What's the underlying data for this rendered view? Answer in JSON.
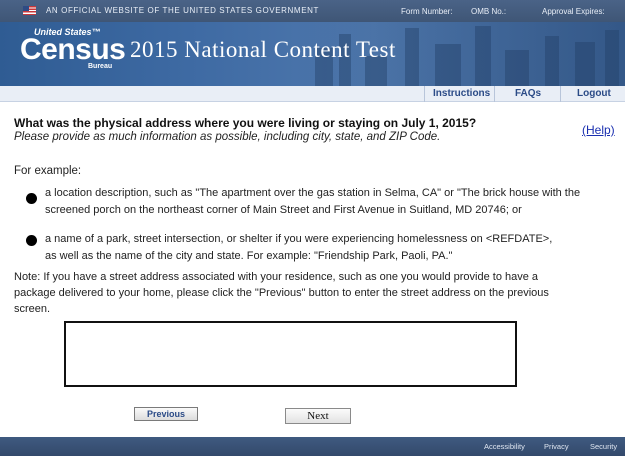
{
  "gov_strip": {
    "text": "AN OFFICIAL WEBSITE OF THE UNITED STATES GOVERNMENT",
    "form_number": "Form Number:",
    "omb_no": "OMB No.:",
    "approval_expires": "Approval Expires:"
  },
  "header": {
    "logo_united_states": "United States™",
    "logo_census": "Census",
    "logo_bureau": "Bureau",
    "title": "2015 National Content Test"
  },
  "nav": {
    "instructions": "Instructions",
    "faqs": "FAQs",
    "logout": "Logout"
  },
  "question": {
    "text": "What was the physical address where you were living or staying on July 1, 2015?",
    "subtitle": "Please provide as much information as possible, including city, state, and ZIP Code.",
    "help": "(Help)"
  },
  "examples": {
    "heading": "For example:",
    "items": [
      {
        "line1": "a location description, such as \"The apartment over the gas station in Selma, CA\" or \"The brick house with the",
        "line2": "screened porch on the northeast corner of Main Street and First Avenue in Suitland, MD 20746; or"
      },
      {
        "line1": "a name of a park, street intersection, or shelter if you were experiencing homelessness on <REFDATE>,",
        "line2": "as well as the name of the city and state.  For example: \"Friendship Park, Paoli, PA.\""
      }
    ]
  },
  "note": {
    "line1": "Note: If you have a street address associated with your residence, such as one you would provide to have a",
    "line2": "package delivered to your home, please click the \"Previous\" button to enter the street address on the previous",
    "line3": "screen."
  },
  "address_input": {
    "value": "",
    "placeholder": ""
  },
  "buttons": {
    "previous": "Previous",
    "next": "Next"
  },
  "footer": {
    "accessibility": "Accessibility",
    "privacy": "Privacy",
    "security": "Security"
  }
}
